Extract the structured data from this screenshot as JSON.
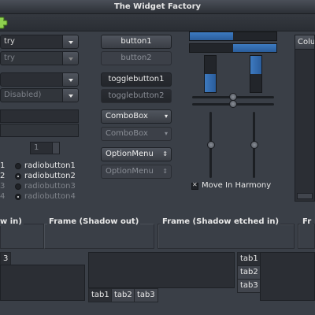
{
  "window": {
    "title": "The Widget Factory"
  },
  "toolbar": {
    "add_icon": "add-icon"
  },
  "left": {
    "entry1": "try",
    "entry2": "try",
    "combo_disabled": "Disabled)",
    "spin_value": "1"
  },
  "radios": {
    "labels_col1": [
      "1",
      "2",
      "3",
      "4"
    ],
    "labels_col2": [
      "radiobutton1",
      "radiobutton2",
      "radiobutton3",
      "radiobutton4"
    ]
  },
  "buttons": {
    "button1": "button1",
    "button2": "button2",
    "toggle1": "togglebutton1",
    "toggle2": "togglebutton2",
    "combobox1": "ComboBox",
    "combobox2": "ComboBox",
    "optionmenu1": "OptionMenu",
    "optionmenu2": "OptionMenu"
  },
  "progress": {
    "h1_fraction": 0.5,
    "h2_fraction": 0.5,
    "v1_fraction": 0.5,
    "v2_fraction": 0.5
  },
  "sliders": {
    "h1_value": 0.5,
    "h2_value": 0.5,
    "v1_value": 0.5,
    "v2_value": 0.5
  },
  "harmony": {
    "label": "Move In Harmony",
    "checked": true
  },
  "frames": {
    "in_label": "w in)",
    "out_label": "Frame (Shadow out)",
    "etched_label": "Frame (Shadow etched in)",
    "etched_out_label": "Fr"
  },
  "notebooks": {
    "nb1_tabs": [
      "3"
    ],
    "nb2_tabs": [
      "tab1",
      "tab2",
      "tab3"
    ],
    "nb3_tabs": [
      "tab1",
      "tab2",
      "tab3"
    ]
  },
  "tree": {
    "column": "Colu"
  }
}
